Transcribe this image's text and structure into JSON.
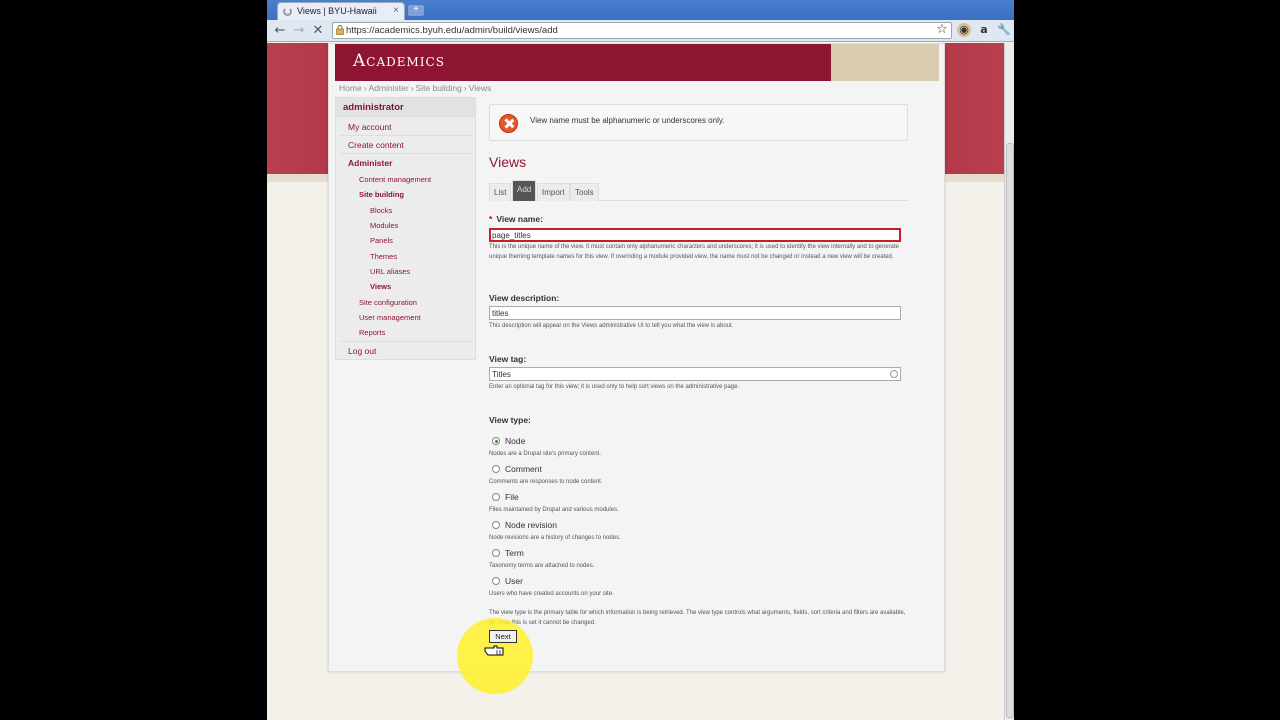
{
  "browser": {
    "tab_title": "Views | BYU-Hawaii",
    "tab_close": "×",
    "new_tab": "+",
    "url": "https://academics.byuh.edu/admin/build/views/add"
  },
  "site": {
    "logo": "Academics",
    "breadcrumb": [
      "Home",
      "Administer",
      "Site building",
      "Views"
    ],
    "breadcrumb_sep": "›"
  },
  "sidebar": {
    "user": "administrator",
    "items": [
      {
        "label": "My account"
      },
      {
        "label": "Create content"
      },
      {
        "label": "Administer"
      },
      {
        "label": "Content management"
      },
      {
        "label": "Site building"
      },
      {
        "label": "Blocks"
      },
      {
        "label": "Modules"
      },
      {
        "label": "Panels"
      },
      {
        "label": "Themes"
      },
      {
        "label": "URL aliases"
      },
      {
        "label": "Views"
      },
      {
        "label": "Site configuration"
      },
      {
        "label": "User management"
      },
      {
        "label": "Reports"
      },
      {
        "label": "Log out"
      }
    ]
  },
  "main": {
    "error_message": "View name must be alphanumeric or underscores only.",
    "title": "Views",
    "tabs": [
      {
        "label": "List"
      },
      {
        "label": "Add"
      },
      {
        "label": "Import"
      },
      {
        "label": "Tools"
      }
    ],
    "form": {
      "required_mark": "*",
      "name_label": "View name:",
      "name_value": "page_titles",
      "name_desc": "This is the unique name of the view. It must contain only alphanumeric characters and underscores; it is used to identify the view internally and to generate unique theming template names for this view. If overriding a module provided view, the name must not be changed or instead a new view will be created.",
      "description_label": "View description:",
      "description_value": "titles",
      "description_desc": "This description will appear on the Views administrative UI to tell you what the view is about.",
      "tag_label": "View tag:",
      "tag_value": "Titles",
      "tag_desc": "Enter an optional tag for this view; it is used only to help sort views on the administrative page.",
      "type_label": "View type:",
      "types": [
        {
          "label": "Node",
          "desc": "Nodes are a Drupal site's primary content.",
          "checked": true
        },
        {
          "label": "Comment",
          "desc": "Comments are responses to node content.",
          "checked": false
        },
        {
          "label": "File",
          "desc": "Files maintained by Drupal and various modules.",
          "checked": false
        },
        {
          "label": "Node revision",
          "desc": "Node revisions are a history of changes to nodes.",
          "checked": false
        },
        {
          "label": "Term",
          "desc": "Taxonomy terms are attached to nodes.",
          "checked": false
        },
        {
          "label": "User",
          "desc": "Users who have created accounts on your site.",
          "checked": false
        }
      ],
      "type_desc": "The view type is the primary table for which information is being retrieved. The view type controls what arguments, fields, sort criteria and filters are available, so once this is set it cannot be changed.",
      "next_label": "Next"
    }
  },
  "colors": {
    "brand": "#8e1531",
    "error_border": "#c42028",
    "highlight": "#fff028"
  }
}
